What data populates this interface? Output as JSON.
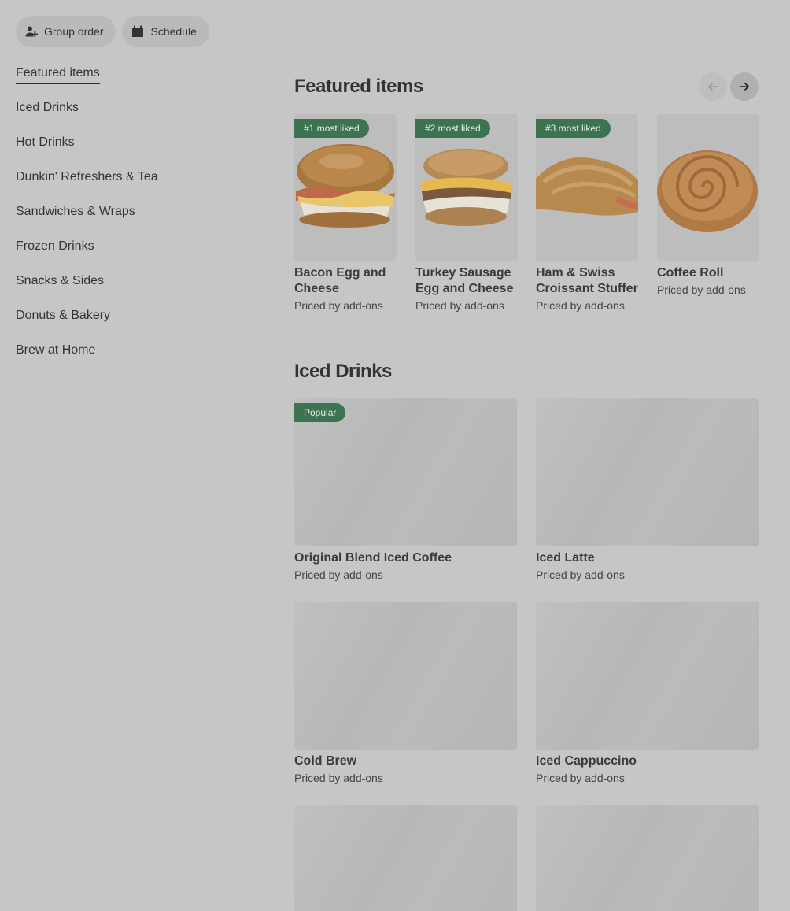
{
  "actions": {
    "group_order": "Group order",
    "schedule": "Schedule"
  },
  "sidebar": {
    "items": [
      {
        "label": "Featured items",
        "active": true
      },
      {
        "label": "Iced Drinks"
      },
      {
        "label": "Hot Drinks"
      },
      {
        "label": "Dunkin' Refreshers & Tea"
      },
      {
        "label": "Sandwiches & Wraps"
      },
      {
        "label": "Frozen Drinks"
      },
      {
        "label": "Snacks & Sides"
      },
      {
        "label": "Donuts & Bakery"
      },
      {
        "label": "Brew at Home"
      }
    ]
  },
  "featured": {
    "title": "Featured items",
    "items": [
      {
        "badge": "#1 most liked",
        "name": "Bacon Egg and Cheese",
        "price": "Priced by add-ons"
      },
      {
        "badge": "#2 most liked",
        "name": "Turkey Sausage Egg and Cheese",
        "price": "Priced by add-ons"
      },
      {
        "badge": "#3 most liked",
        "name": "Ham & Swiss Croissant Stuffer",
        "price": "Priced by add-ons"
      },
      {
        "badge": "",
        "name": "Coffee Roll",
        "price": "Priced by add-ons"
      }
    ]
  },
  "iced": {
    "title": "Iced Drinks",
    "items": [
      {
        "badge": "Popular",
        "name": "Original Blend Iced Coffee",
        "price": "Priced by add-ons"
      },
      {
        "badge": "",
        "name": "Iced Latte",
        "price": "Priced by add-ons"
      },
      {
        "badge": "",
        "name": "Cold Brew",
        "price": "Priced by add-ons"
      },
      {
        "badge": "",
        "name": "Iced Cappuccino",
        "price": "Priced by add-ons"
      },
      {
        "badge": "",
        "name": "",
        "price": ""
      },
      {
        "badge": "",
        "name": "",
        "price": ""
      }
    ]
  },
  "colors": {
    "badge": "#3c7350",
    "background": "#c6c6c6"
  }
}
